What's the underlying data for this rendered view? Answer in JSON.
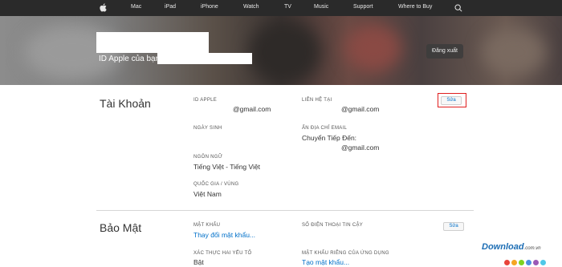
{
  "nav": {
    "items": [
      "Mac",
      "iPad",
      "iPhone",
      "Watch",
      "TV",
      "Music",
      "Support",
      "Where to Buy"
    ]
  },
  "hero": {
    "title": "ID Apple của bạn",
    "signout_label": "Đăng xuất"
  },
  "account": {
    "title": "Tài Khoản",
    "edit_label": "Sửa",
    "apple_id_label": "ID APPLE",
    "apple_id_value": "@gmail.com",
    "contact_label": "LIÊN HỆ TẠI",
    "contact_value": "@gmail.com",
    "birthday_label": "NGÀY SINH",
    "notify_label": "ẨN ĐỊA CHỈ EMAIL",
    "notify_value1": "Chuyển Tiếp Đến:",
    "notify_value2": "@gmail.com",
    "language_label": "NGÔN NGỮ",
    "language_value": "Tiếng Việt - Tiếng Việt",
    "country_label": "QUỐC GIA / VÙNG",
    "country_value": "Việt Nam"
  },
  "security": {
    "title": "Bảo Mật",
    "edit_label": "Sửa",
    "password_label": "MẬT KHẨU",
    "password_link": "Thay đổi mật khẩu...",
    "phone_label": "SỐ ĐIỆN THOẠI TIN CẬY",
    "twofactor_label": "XÁC THỰC HAI YẾU TỐ",
    "twofactor_value": "Bật",
    "app_password_label": "MẬT KHẨU RIÊNG CỦA ỨNG DỤNG",
    "app_password_link": "Tạo mật khẩu..."
  },
  "watermark": {
    "text": "Download",
    "suffix": ".com.vn"
  },
  "colors": {
    "link": "#0070c9",
    "highlight": "#e01e1e",
    "nav_bg": "#2a2a2a"
  }
}
